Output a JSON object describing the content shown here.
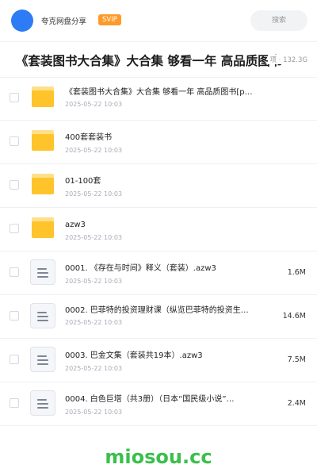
{
  "header": {
    "share_name": "夸克网盘分享",
    "badge": "SVIP",
    "search_placeholder": "搜索"
  },
  "title": {
    "text": "《套装图书大合集》大合集 够看一年 高品质图书",
    "meta": "项 · 132.3G"
  },
  "files": [
    {
      "type": "folder",
      "name": "《套装图书大合集》大合集 够看一年 高品质图书[p…",
      "date": "2025-05-22 10:03",
      "size": ""
    },
    {
      "type": "folder",
      "name": "400套套装书",
      "date": "2025-05-22 10:03",
      "size": ""
    },
    {
      "type": "folder",
      "name": "01-100套",
      "date": "2025-05-22 10:03",
      "size": ""
    },
    {
      "type": "folder",
      "name": "azw3",
      "date": "2025-05-22 10:03",
      "size": ""
    },
    {
      "type": "file",
      "name": "0001. 《存在与时间》释义（套装）.azw3",
      "date": "2025-05-22 10:03",
      "size": "1.6M"
    },
    {
      "type": "file",
      "name": "0002. 巴菲特的投资理财课（纵览巴菲特的投资生…",
      "date": "2025-05-22 10:03",
      "size": "14.6M"
    },
    {
      "type": "file",
      "name": "0003. 巴金文集（套装共19本）.azw3",
      "date": "2025-05-22 10:03",
      "size": "7.5M"
    },
    {
      "type": "file",
      "name": "0004. 白色巨塔（共3册）（日本“国民级小说”…",
      "date": "2025-05-22 10:03",
      "size": "2.4M"
    }
  ],
  "watermark": "miosou.cc"
}
